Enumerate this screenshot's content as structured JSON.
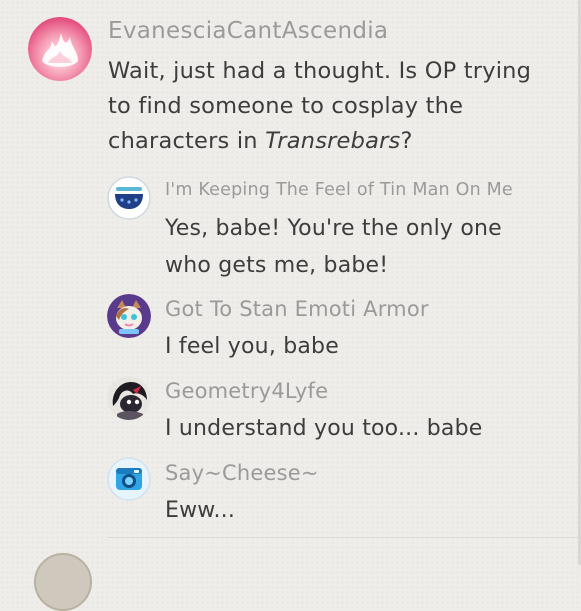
{
  "thread": {
    "main_comment": {
      "username": "EvanesciaCantAscendia",
      "text_line1": "Wait, just had a thought. Is OP trying",
      "text_line2": "to find someone to cosplay the",
      "text_line3_prefix": "characters in ",
      "text_line3_italic": "Transrebars",
      "text_line3_suffix": "?",
      "avatar_icon": "pink-flame-avatar-icon"
    },
    "replies": [
      {
        "username": "I'm Keeping The Feel of Tin Man On Me",
        "text_line1": "Yes, babe! You're the only one",
        "text_line2": "who gets me, babe!",
        "avatar_icon": "blue-bowl-avatar-icon"
      },
      {
        "username": "Got To Stan Emoti Armor",
        "text_line1": "I feel you, babe",
        "avatar_icon": "cat-mask-avatar-icon"
      },
      {
        "username": "Geometry4Lyfe",
        "text_line1": "I understand you too... babe",
        "avatar_icon": "dark-character-avatar-icon"
      },
      {
        "username": "Say~Cheese~",
        "text_line1": "Eww...",
        "avatar_icon": "camera-avatar-icon"
      }
    ]
  },
  "colors": {
    "background": "#efedea",
    "username": "#9a9a9a",
    "body_text": "#3d3d3d"
  }
}
